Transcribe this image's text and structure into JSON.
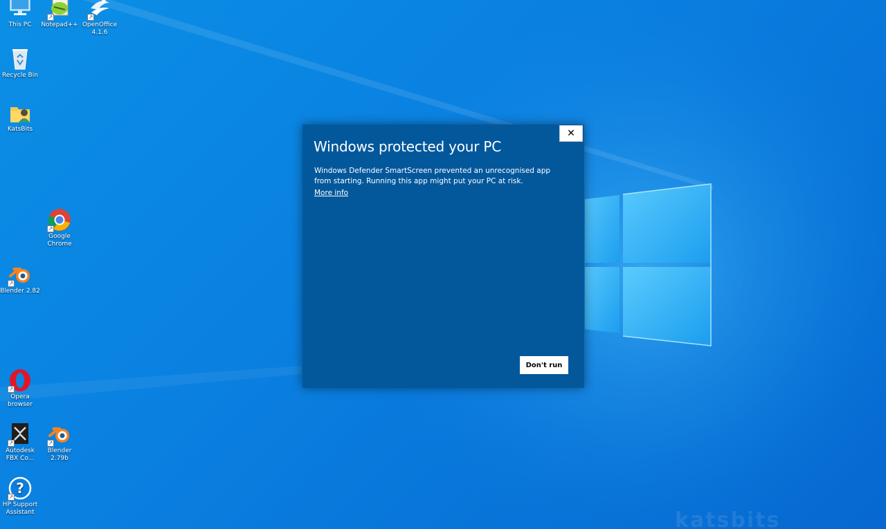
{
  "desktop": {
    "background_colors": [
      "#0b8fe6",
      "#0668d0"
    ],
    "icons": [
      {
        "label": "This PC",
        "icon": "computer-icon",
        "shortcut": false
      },
      {
        "label": "Notepad++",
        "icon": "notepad-plus-plus-icon",
        "shortcut": true
      },
      {
        "label": "OpenOffice 4.1.6",
        "icon": "openoffice-icon",
        "shortcut": true
      },
      {
        "label": "Recycle Bin",
        "icon": "recycle-bin-icon",
        "shortcut": false
      },
      {
        "label": "KatsBits",
        "icon": "user-folder-icon",
        "shortcut": false
      },
      {
        "label": "Google Chrome",
        "icon": "chrome-icon",
        "shortcut": true
      },
      {
        "label": "Blender 2.82",
        "icon": "blender-icon",
        "shortcut": true
      },
      {
        "label": "Opera browser",
        "icon": "opera-icon",
        "shortcut": true
      },
      {
        "label": "Autodesk FBX Co...",
        "icon": "fbx-converter-icon",
        "shortcut": true
      },
      {
        "label": "Blender 2.79b",
        "icon": "blender-icon",
        "shortcut": true
      },
      {
        "label": "HP Support Assistant",
        "icon": "help-icon",
        "shortcut": true
      }
    ],
    "shortcut_glyph": "↗",
    "watermark": "katsbits"
  },
  "dialog": {
    "title": "Windows protected your PC",
    "message": "Windows Defender SmartScreen prevented an unrecognised app from starting. Running this app might put your PC at risk.",
    "more_info": "More info",
    "close_glyph": "✕",
    "dont_run": "Don't run",
    "background_color": "#03589c"
  }
}
